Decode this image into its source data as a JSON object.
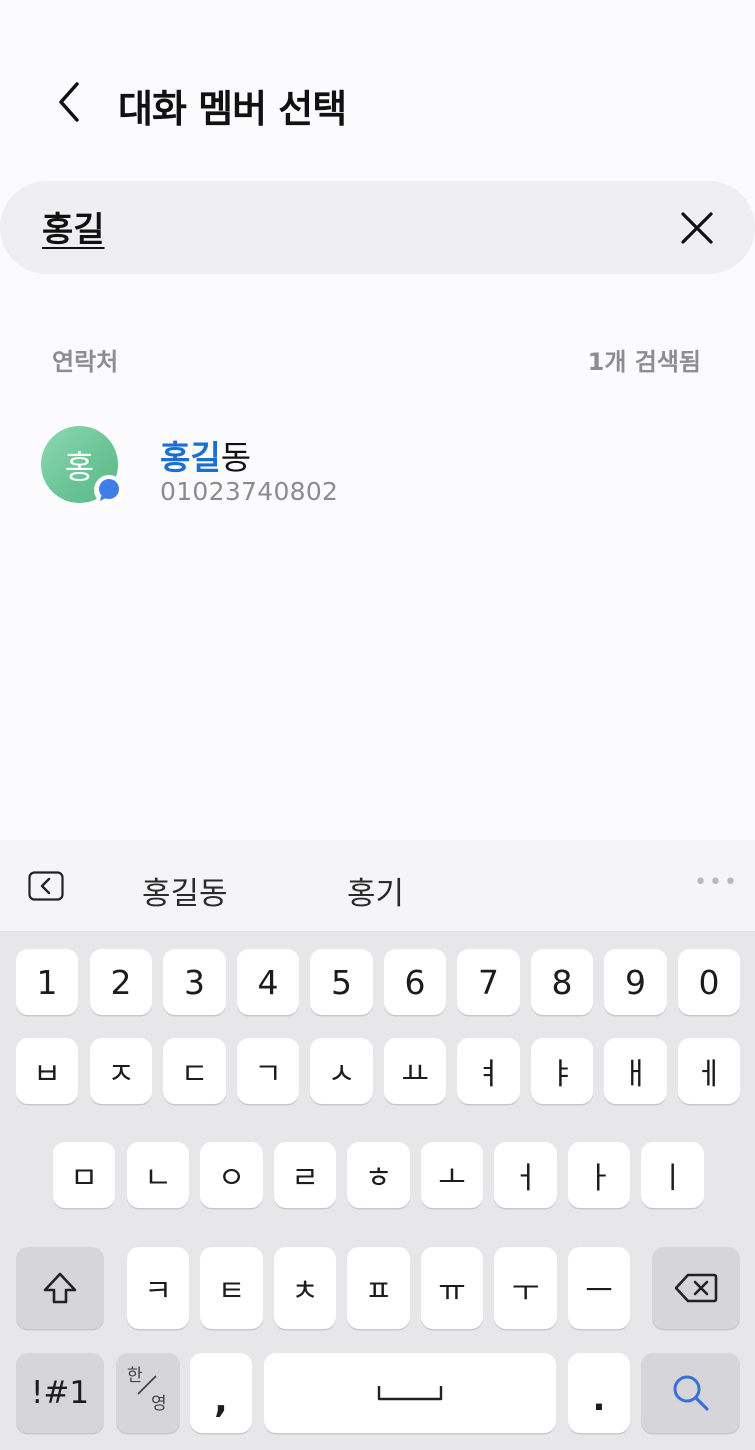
{
  "header": {
    "title": "대화 멤버 선택"
  },
  "search": {
    "value": "홍길"
  },
  "section": {
    "label": "연락처",
    "count": "1개 검색됨"
  },
  "contact": {
    "avatar_initial": "홍",
    "name_match": "홍길",
    "name_rest": "동",
    "phone": "01023740802"
  },
  "keyboard": {
    "suggestions": [
      "홍길동",
      "홍기"
    ],
    "more_label": "•••",
    "row_numbers": [
      "1",
      "2",
      "3",
      "4",
      "5",
      "6",
      "7",
      "8",
      "9",
      "0"
    ],
    "row1": [
      "ㅂ",
      "ㅈ",
      "ㄷ",
      "ㄱ",
      "ㅅ",
      "ㅛ",
      "ㅕ",
      "ㅑ",
      "ㅐ",
      "ㅔ"
    ],
    "row2": [
      "ㅁ",
      "ㄴ",
      "ㅇ",
      "ㄹ",
      "ㅎ",
      "ㅗ",
      "ㅓ",
      "ㅏ",
      "ㅣ"
    ],
    "row3": [
      "ㅋ",
      "ㅌ",
      "ㅊ",
      "ㅍ",
      "ㅠ",
      "ㅜ",
      "ㅡ"
    ],
    "symbols_label": "!#1",
    "lang_top": "한",
    "lang_bottom": "영",
    "comma_label": ",",
    "period_label": "."
  },
  "colors": {
    "highlight": "#1b6fd1",
    "avatar": "#6cc597",
    "badge": "#3f7ee8",
    "search_key_icon": "#3a6fd8"
  }
}
